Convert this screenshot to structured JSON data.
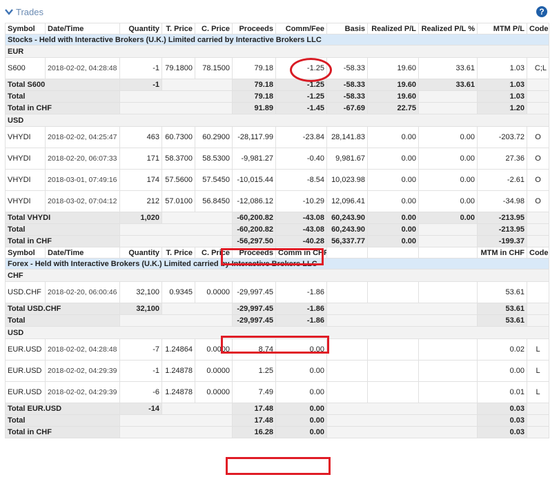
{
  "section": {
    "title": "Trades",
    "help": "?"
  },
  "headers": {
    "symbol": "Symbol",
    "datetime": "Date/Time",
    "quantity": "Quantity",
    "tprice": "T. Price",
    "cprice": "C. Price",
    "proceeds": "Proceeds",
    "commfee": "Comm/Fee",
    "basis": "Basis",
    "realized_pl": "Realized P/L",
    "realized_pl_pct": "Realized P/L %",
    "mtm_pl": "MTM P/L",
    "code": "Code"
  },
  "headers2": {
    "symbol": "Symbol",
    "datetime": "Date/Time",
    "quantity": "Quantity",
    "tprice": "T. Price",
    "cprice": "C. Price",
    "proceeds": "Proceeds",
    "comm_chf": "Comm in CHF",
    "mtm_chf": "MTM in CHF",
    "code": "Code"
  },
  "stocks": {
    "title": "Stocks - Held with Interactive Brokers (U.K.) Limited carried by Interactive Brokers LLC",
    "eur": {
      "currency": "EUR",
      "rows": [
        {
          "symbol": "S600",
          "datetime": "2018-02-02, 04:28:48",
          "quantity": "-1",
          "tprice": "79.1800",
          "cprice": "78.1500",
          "proceeds": "79.18",
          "commfee": "-1.25",
          "basis": "-58.33",
          "realized_pl": "19.60",
          "realized_pl_pct": "33.61",
          "mtm_pl": "1.03",
          "code": "C;L"
        }
      ],
      "total_symbol": {
        "label": "Total S600",
        "quantity": "-1",
        "proceeds": "79.18",
        "commfee": "-1.25",
        "basis": "-58.33",
        "realized_pl": "19.60",
        "realized_pl_pct": "33.61",
        "mtm_pl": "1.03"
      },
      "total": {
        "label": "Total",
        "proceeds": "79.18",
        "commfee": "-1.25",
        "basis": "-58.33",
        "realized_pl": "19.60",
        "mtm_pl": "1.03"
      },
      "total_chf": {
        "label": "Total in CHF",
        "proceeds": "91.89",
        "commfee": "-1.45",
        "basis": "-67.69",
        "realized_pl": "22.75",
        "mtm_pl": "1.20"
      }
    },
    "usd": {
      "currency": "USD",
      "rows": [
        {
          "symbol": "VHYDI",
          "datetime": "2018-02-02, 04:25:47",
          "quantity": "463",
          "tprice": "60.7300",
          "cprice": "60.2900",
          "proceeds": "-28,117.99",
          "commfee": "-23.84",
          "basis": "28,141.83",
          "realized_pl": "0.00",
          "realized_pl_pct": "0.00",
          "mtm_pl": "-203.72",
          "code": "O"
        },
        {
          "symbol": "VHYDI",
          "datetime": "2018-02-20, 06:07:33",
          "quantity": "171",
          "tprice": "58.3700",
          "cprice": "58.5300",
          "proceeds": "-9,981.27",
          "commfee": "-0.40",
          "basis": "9,981.67",
          "realized_pl": "0.00",
          "realized_pl_pct": "0.00",
          "mtm_pl": "27.36",
          "code": "O"
        },
        {
          "symbol": "VHYDI",
          "datetime": "2018-03-01, 07:49:16",
          "quantity": "174",
          "tprice": "57.5600",
          "cprice": "57.5450",
          "proceeds": "-10,015.44",
          "commfee": "-8.54",
          "basis": "10,023.98",
          "realized_pl": "0.00",
          "realized_pl_pct": "0.00",
          "mtm_pl": "-2.61",
          "code": "O"
        },
        {
          "symbol": "VHYDI",
          "datetime": "2018-03-02, 07:04:12",
          "quantity": "212",
          "tprice": "57.0100",
          "cprice": "56.8450",
          "proceeds": "-12,086.12",
          "commfee": "-10.29",
          "basis": "12,096.41",
          "realized_pl": "0.00",
          "realized_pl_pct": "0.00",
          "mtm_pl": "-34.98",
          "code": "O"
        }
      ],
      "total_symbol": {
        "label": "Total VHYDI",
        "quantity": "1,020",
        "proceeds": "-60,200.82",
        "commfee": "-43.08",
        "basis": "60,243.90",
        "realized_pl": "0.00",
        "realized_pl_pct": "0.00",
        "mtm_pl": "-213.95"
      },
      "total": {
        "label": "Total",
        "proceeds": "-60,200.82",
        "commfee": "-43.08",
        "basis": "60,243.90",
        "realized_pl": "0.00",
        "mtm_pl": "-213.95"
      },
      "total_chf": {
        "label": "Total in CHF",
        "proceeds": "-56,297.50",
        "commfee": "-40.28",
        "basis": "56,337.77",
        "realized_pl": "0.00",
        "mtm_pl": "-199.37"
      }
    }
  },
  "forex": {
    "title": "Forex - Held with Interactive Brokers (U.K.) Limited carried by Interactive Brokers LLC",
    "chf": {
      "currency": "CHF",
      "rows": [
        {
          "symbol": "USD.CHF",
          "datetime": "2018-02-20, 06:00:46",
          "quantity": "32,100",
          "tprice": "0.9345",
          "cprice": "0.0000",
          "proceeds": "-29,997.45",
          "comm": "-1.86",
          "mtm": "53.61",
          "code": ""
        }
      ],
      "total_symbol": {
        "label": "Total USD.CHF",
        "quantity": "32,100",
        "proceeds": "-29,997.45",
        "comm": "-1.86",
        "mtm": "53.61"
      },
      "total": {
        "label": "Total",
        "proceeds": "-29,997.45",
        "comm": "-1.86",
        "mtm": "53.61"
      }
    },
    "usd": {
      "currency": "USD",
      "rows": [
        {
          "symbol": "EUR.USD",
          "datetime": "2018-02-02, 04:28:48",
          "quantity": "-7",
          "tprice": "1.24864",
          "cprice": "0.0000",
          "proceeds": "8.74",
          "comm": "0.00",
          "mtm": "0.02",
          "code": "L"
        },
        {
          "symbol": "EUR.USD",
          "datetime": "2018-02-02, 04:29:39",
          "quantity": "-1",
          "tprice": "1.24878",
          "cprice": "0.0000",
          "proceeds": "1.25",
          "comm": "0.00",
          "mtm": "0.00",
          "code": "L"
        },
        {
          "symbol": "EUR.USD",
          "datetime": "2018-02-02, 04:29:39",
          "quantity": "-6",
          "tprice": "1.24878",
          "cprice": "0.0000",
          "proceeds": "7.49",
          "comm": "0.00",
          "mtm": "0.01",
          "code": "L"
        }
      ],
      "total_symbol": {
        "label": "Total EUR.USD",
        "quantity": "-14",
        "proceeds": "17.48",
        "comm": "0.00",
        "mtm": "0.03"
      },
      "total": {
        "label": "Total",
        "proceeds": "17.48",
        "comm": "0.00",
        "mtm": "0.03"
      },
      "total_chf": {
        "label": "Total in CHF",
        "proceeds": "16.28",
        "comm": "0.00",
        "mtm": "0.03"
      }
    }
  },
  "colors": {
    "highlight": "#e01c26",
    "section_bg": "#d9e9f8",
    "total_bg": "#e8e8e8",
    "title": "#6a8bb3"
  }
}
